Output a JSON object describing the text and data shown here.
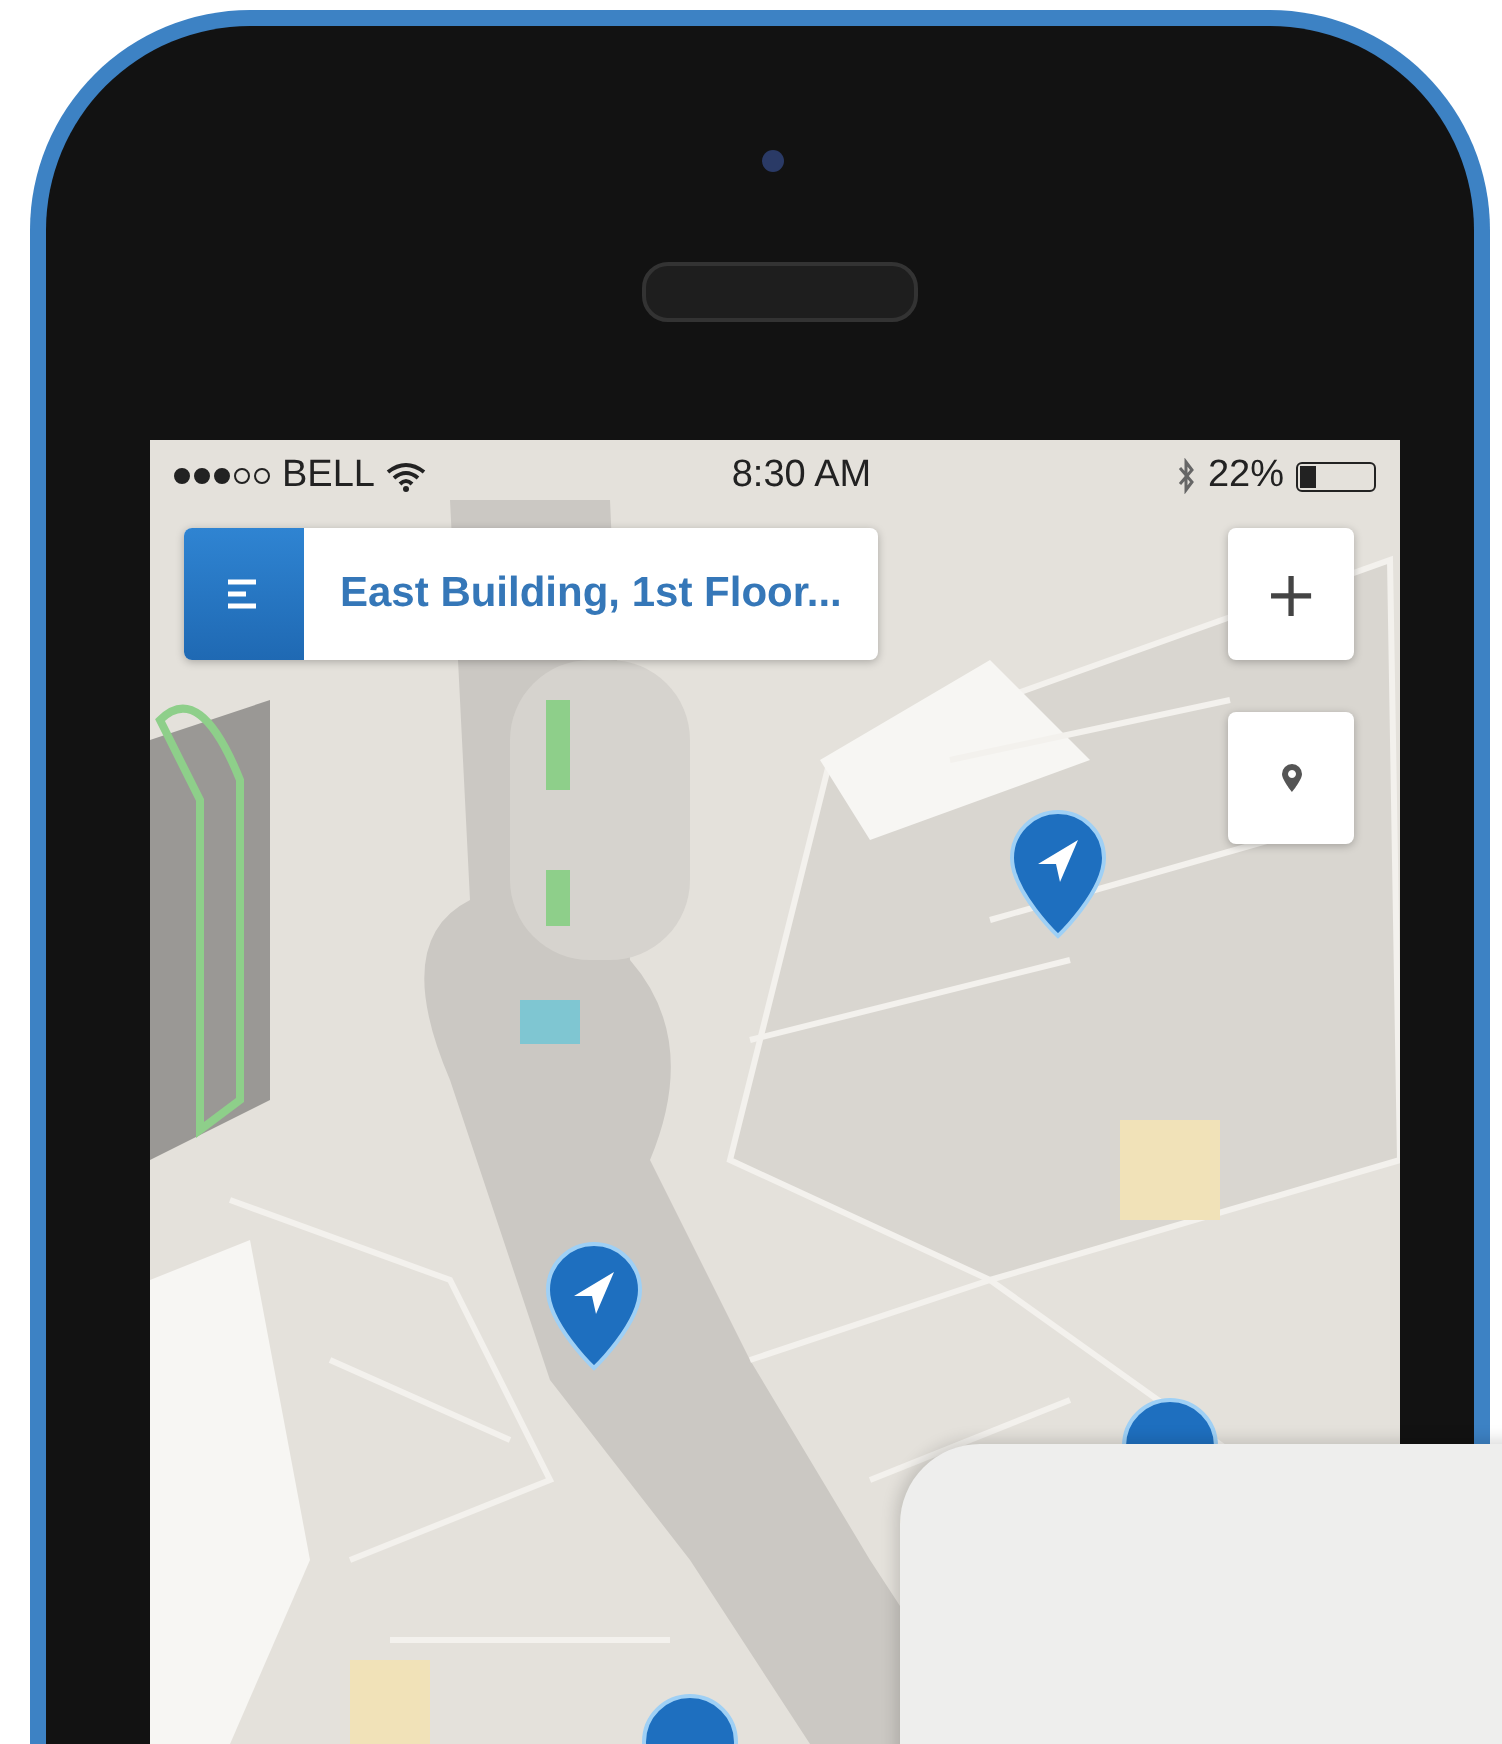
{
  "status_bar": {
    "carrier": "BELL",
    "time": "8:30 AM",
    "battery": "22%"
  },
  "search": {
    "value": "East Building, 1st Floor..."
  },
  "zoom_button": {
    "label": "+"
  }
}
